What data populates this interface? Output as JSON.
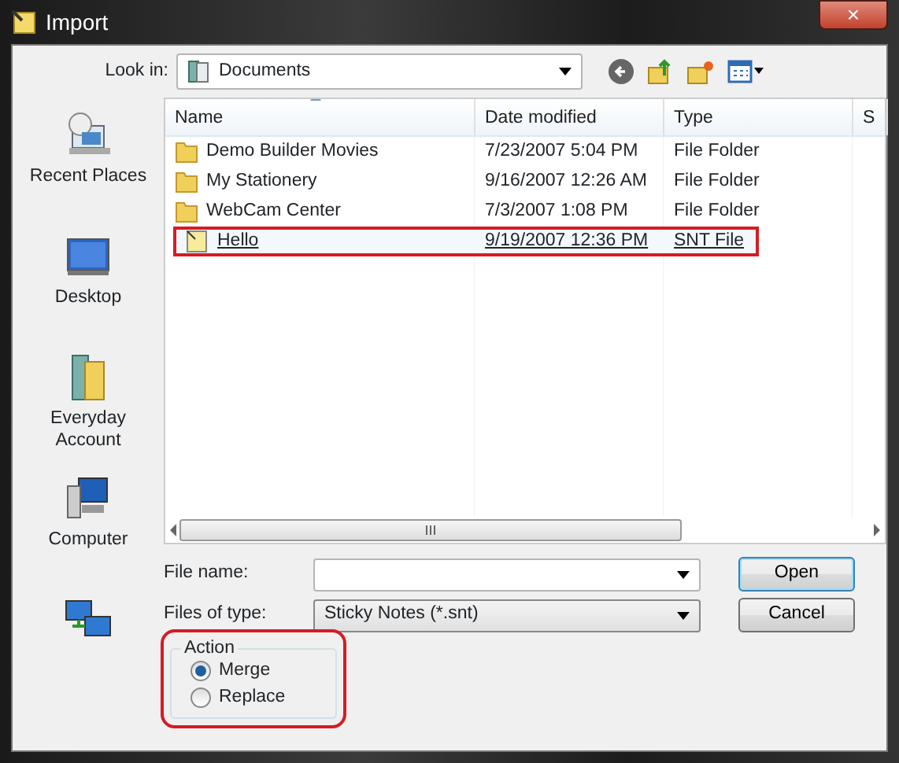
{
  "window": {
    "title": "Import",
    "close": "×"
  },
  "look_in": {
    "label": "Look in:",
    "value": "Documents"
  },
  "places": [
    {
      "label": "Recent Places",
      "kind": "recent"
    },
    {
      "label": "Desktop",
      "kind": "desktop"
    },
    {
      "label": "Everyday Account",
      "kind": "user"
    },
    {
      "label": "Computer",
      "kind": "computer"
    },
    {
      "kind": "network"
    }
  ],
  "table": {
    "columns": [
      "Name",
      "Date modified",
      "Type",
      "S"
    ],
    "rows": [
      {
        "name": "Demo Builder Movies",
        "date": "7/23/2007 5:04 PM",
        "type": "File Folder",
        "kind": "folder",
        "selected": false,
        "marked": false
      },
      {
        "name": "My Stationery",
        "date": "9/16/2007 12:26 AM",
        "type": "File Folder",
        "kind": "folder",
        "selected": false,
        "marked": false
      },
      {
        "name": "WebCam Center",
        "date": "7/3/2007 1:08 PM",
        "type": "File Folder",
        "kind": "folder",
        "selected": false,
        "marked": false
      },
      {
        "name": "Hello",
        "date": "9/19/2007 12:36 PM",
        "type": "SNT File",
        "kind": "file",
        "selected": true,
        "marked": true
      }
    ]
  },
  "file_name": {
    "label": "File name:"
  },
  "file_type": {
    "label": "Files of type:",
    "value": "Sticky Notes (*.snt)"
  },
  "buttons": [
    "Open",
    "Cancel"
  ],
  "action": {
    "title": "Action",
    "marked": true,
    "options": [
      {
        "label": "Merge",
        "selected": true
      },
      {
        "label": "Replace",
        "selected": false
      }
    ]
  }
}
